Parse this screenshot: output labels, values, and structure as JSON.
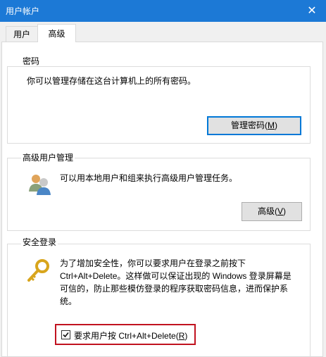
{
  "window": {
    "title": "用户帐户",
    "close_glyph": "✕"
  },
  "tabs": [
    {
      "label": "用户",
      "selected": false
    },
    {
      "label": "高级",
      "selected": true
    }
  ],
  "passwords": {
    "group_label": "密码",
    "description": "你可以管理存储在这台计算机上的所有密码。",
    "button_label": "管理密码(",
    "button_mnemonic": "M",
    "button_suffix": ")"
  },
  "advanced_user_management": {
    "group_label": "高级用户管理",
    "description": "可以用本地用户和组来执行高级用户管理任务。",
    "icon": "users-group-icon",
    "button_label": "高级(",
    "button_mnemonic": "V",
    "button_suffix": ")"
  },
  "secure_logon": {
    "group_label": "安全登录",
    "icon": "key-icon",
    "description_lines": [
      "为了增加安全性，你可以要求用户在登录之前按下",
      "Ctrl+Alt+Delete。这样做可以保证出现的 Windows 登录屏幕是",
      "可信的，防止那些模仿登录的程序获取密码信息，进而保护系",
      "统。"
    ],
    "checkbox_label": "要求用户按 Ctrl+Alt+Delete(",
    "checkbox_mnemonic": "R",
    "checkbox_suffix": ")",
    "checkbox_checked": true
  },
  "colors": {
    "titlebar": "#1c79d6",
    "focus_border": "#0078d7",
    "highlight_border": "#c1121f"
  }
}
